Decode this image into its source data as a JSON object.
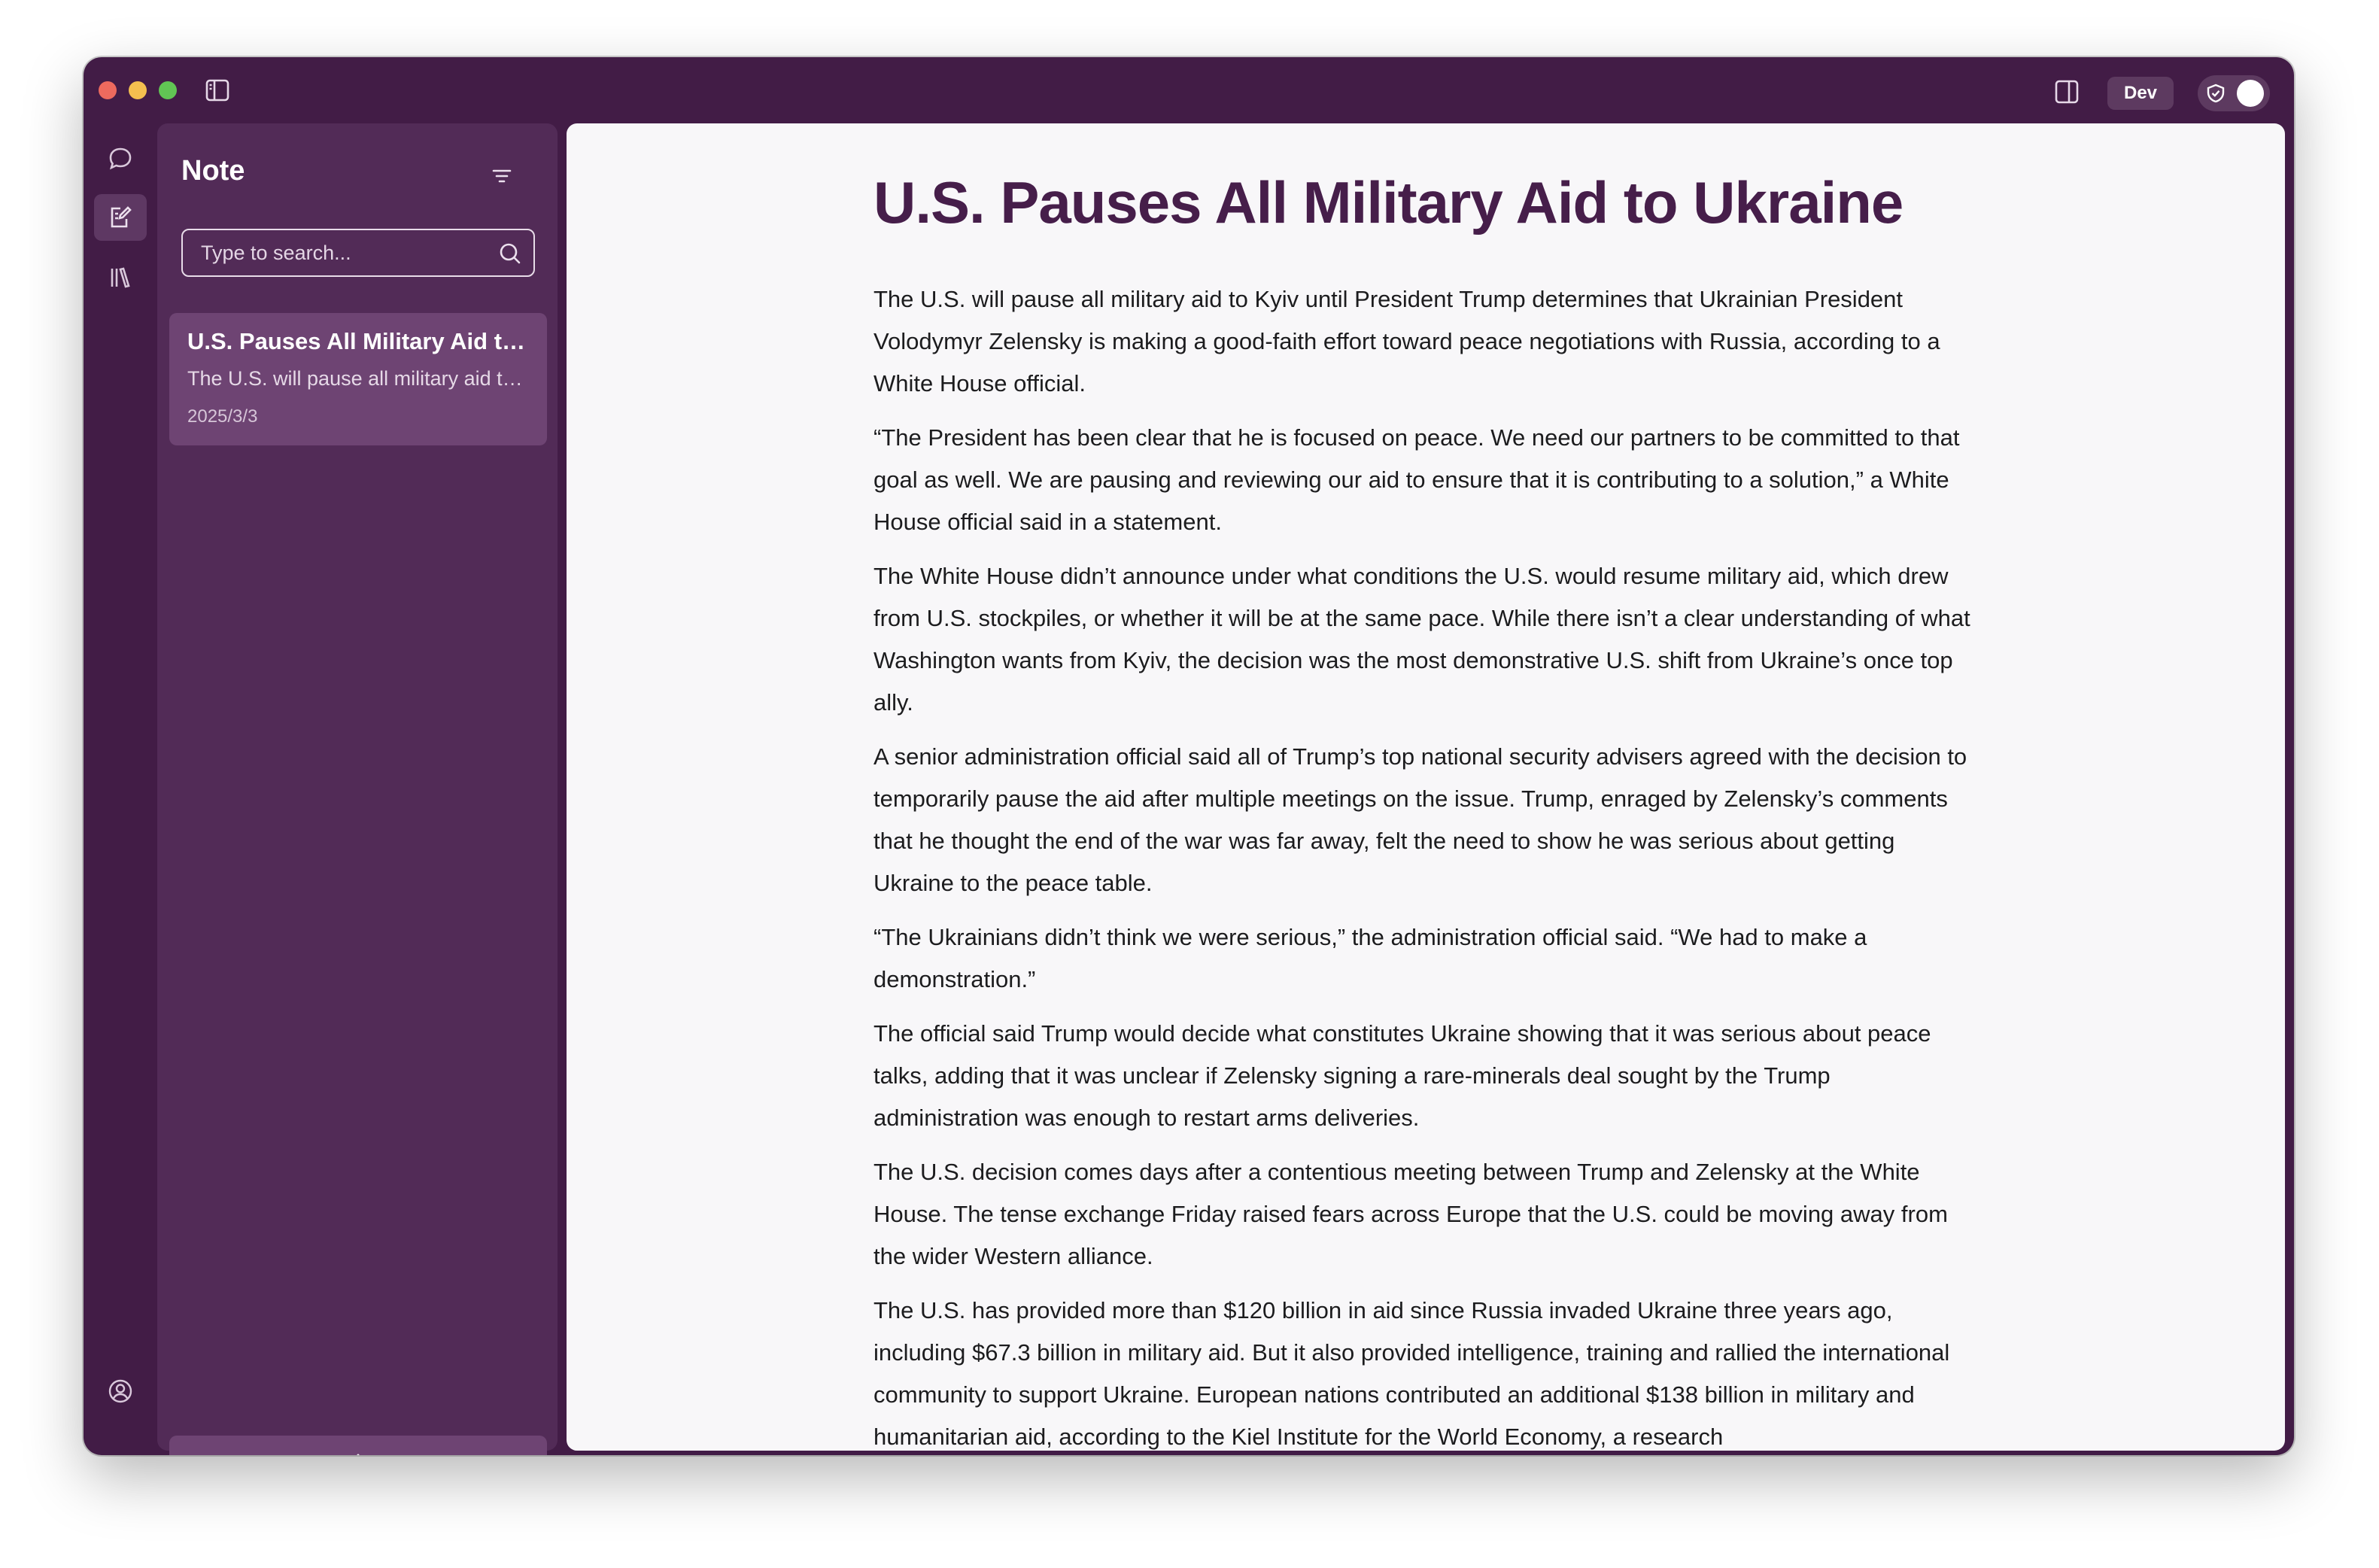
{
  "titlebar": {
    "env_badge": "Dev"
  },
  "icons": {
    "sidebar_toggle": "sidebar-toggle-icon",
    "right_panel": "right-panel-icon",
    "shield": "shield-icon",
    "chat": "chat-icon",
    "notes": "notes-icon",
    "library": "library-icon",
    "user": "user-icon",
    "filter": "filter-icon",
    "search": "search-icon",
    "add": "plus-icon"
  },
  "notes_panel": {
    "title": "Note",
    "search_placeholder": "Type to search...",
    "notes": [
      {
        "title": "U.S. Pauses All Military Aid to Ukraine",
        "preview": "The U.S. will pause all military aid to Kyiv until President Trump determines",
        "date": "2025/3/3"
      }
    ]
  },
  "article": {
    "title": "U.S. Pauses All Military Aid to Ukraine",
    "paragraphs": [
      "The U.S. will pause all military aid to Kyiv until President Trump determines that Ukrainian President Volodymyr Zelensky is making a good-faith effort toward peace negotiations with Russia, according to a White House official.",
      "“The President has been clear that he is focused on peace. We need our partners to be committed to that goal as well. We are pausing and reviewing our aid to ensure that it is contributing to a solution,” a White House official said in a statement.",
      "The White House didn’t announce under what conditions the U.S. would resume military aid, which drew from U.S. stockpiles, or whether it will be at the same pace. While there isn’t a clear understanding of what Washington wants from Kyiv, the decision was the most demonstrative U.S. shift from Ukraine’s once top ally.",
      "A senior administration official said all of Trump’s top national security advisers agreed with the decision to temporarily pause the aid after multiple meetings on the issue. Trump, enraged by Zelensky’s comments that he thought the end of the war was far away, felt the need to show he was serious about getting Ukraine to the peace table.",
      "“The Ukrainians didn’t think we were serious,” the administration official said. “We had to make a demonstration.”",
      "The official said Trump would decide what constitutes Ukraine showing that it was serious about peace talks, adding that it was unclear if Zelensky signing a rare-minerals deal sought by the Trump administration was enough to restart arms deliveries.",
      "The U.S. decision comes days after a contentious meeting between Trump and Zelensky at the White House. The tense exchange Friday raised fears across Europe that the U.S. could be moving away from the wider Western alliance.",
      "The U.S. has provided more than $120 billion in aid since Russia invaded Ukraine three years ago, including $67.3 billion in military aid. But it also provided intelligence, training and rallied the international community to support Ukraine. European nations contributed an additional $138 billion in military and humanitarian aid, according to the Kiel Institute for the World Economy, a research"
    ]
  }
}
